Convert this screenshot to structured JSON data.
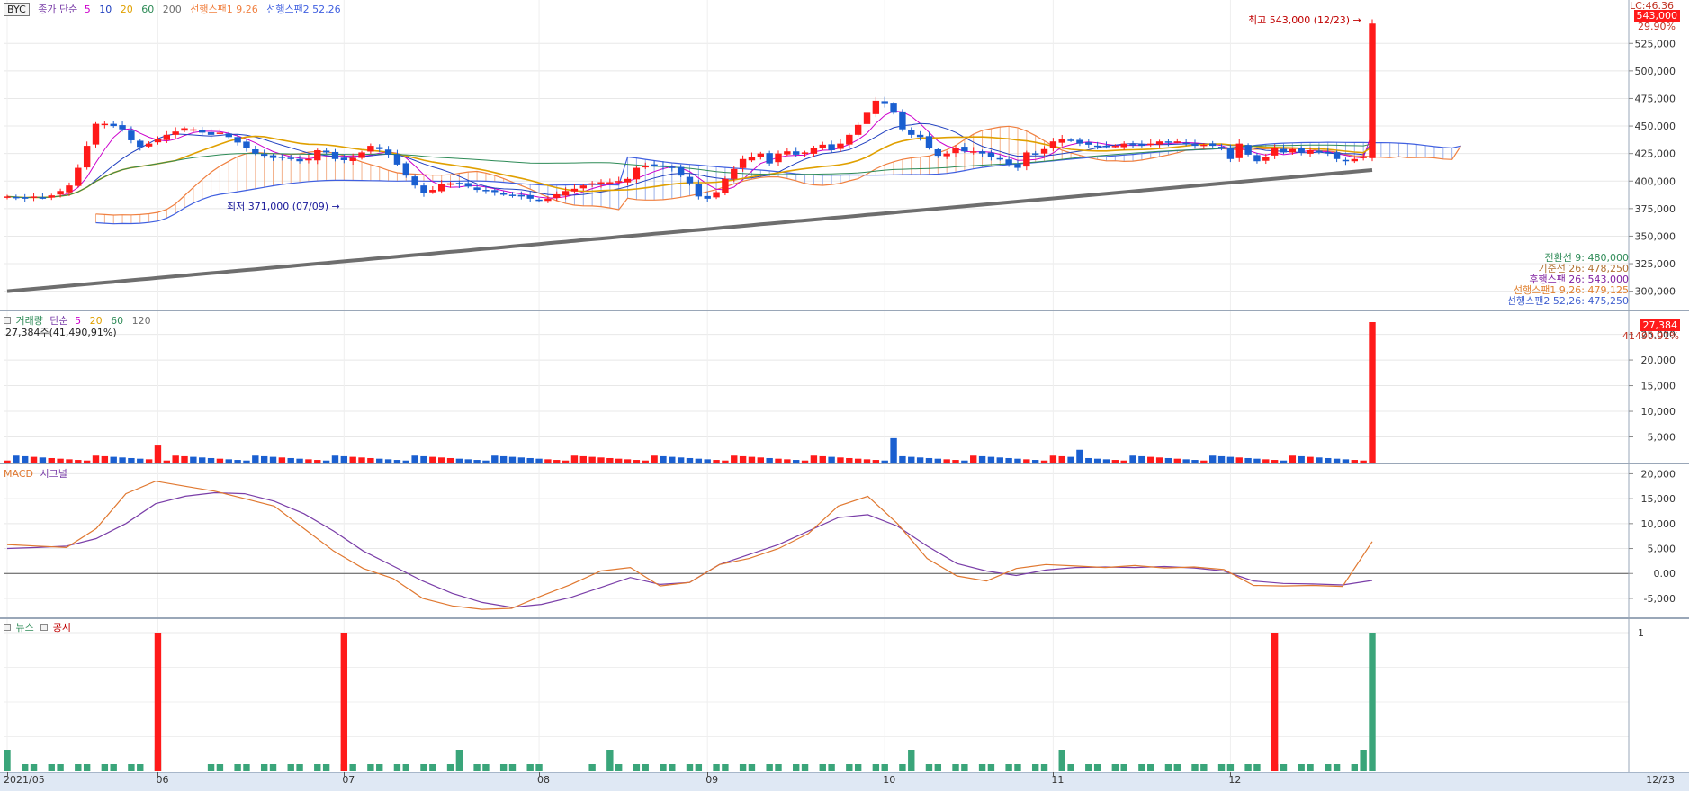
{
  "symbol": "BYC",
  "price_legend": {
    "prefix": "종가 단순",
    "mas": [
      "5",
      "10",
      "20",
      "60",
      "200"
    ],
    "span1": "선행스팬1 9,26",
    "span2": "선행스팬2 52,26"
  },
  "header_right": {
    "lc": "LC:46.36",
    "price_tag": "543,000",
    "pct": "29.90%"
  },
  "annotations": {
    "high": "최고 543,000 (12/23)",
    "low": "최저 371,000 (07/09)"
  },
  "ichimoku_labels": [
    {
      "text": "전환선 9: 480,000",
      "color": "#2e8b57"
    },
    {
      "text": "기준선 26: 478,250",
      "color": "#b07030"
    },
    {
      "text": "후행스팬 26: 543,000",
      "color": "#8020a0"
    },
    {
      "text": "선행스팬1 9,26: 479,125",
      "color": "#e08030"
    },
    {
      "text": "선행스팬2 52,26: 475,250",
      "color": "#4060d0"
    }
  ],
  "volume_legend": {
    "title": "거래량",
    "prefix": "단순",
    "mas": [
      "5",
      "20",
      "60",
      "120"
    ],
    "value": "27,384주(41,490,91%)",
    "last_tag": "27,384",
    "last_pct": "41490.91%"
  },
  "macd_legend": {
    "macd": "MACD",
    "signal": "시그널"
  },
  "news_legend": {
    "news": "뉴스",
    "disclosure": "공시"
  },
  "x_labels": [
    {
      "label": "2021/05",
      "i": 0
    },
    {
      "label": "06",
      "i": 17
    },
    {
      "label": "07",
      "i": 38
    },
    {
      "label": "08",
      "i": 60
    },
    {
      "label": "09",
      "i": 79
    },
    {
      "label": "10",
      "i": 99
    },
    {
      "label": "11",
      "i": 118
    },
    {
      "label": "12",
      "i": 138
    }
  ],
  "x_right_label": "12/23",
  "colors": {
    "up": "#ff1a1a",
    "down": "#1a5fd0",
    "ma5": "#cc00cc",
    "ma10": "#2040c0",
    "ma20": "#e0a000",
    "ma60": "#2e8b57",
    "ma200": "#6e6e6e",
    "span1": "#f08040",
    "span2": "#4060e0",
    "macd": "#7a3ea8",
    "signal": "#e07830",
    "news": "#3aa57a",
    "disclosure": "#ff1a1a"
  },
  "chart_data": [
    {
      "type": "candlestick",
      "title": "BYC",
      "ylim": [
        285000,
        553000
      ],
      "y_ticks": [
        300000,
        325000,
        350000,
        375000,
        400000,
        425000,
        450000,
        475000,
        500000,
        525000
      ],
      "y_tick_labels": [
        "300,000",
        "325,000",
        "350,000",
        "375,000",
        "400,000",
        "425,000",
        "450,000",
        "475,000",
        "500,000",
        "525,000"
      ],
      "series": [
        {
          "name": "close",
          "values": [
            386000,
            385000,
            384000,
            386000,
            385000,
            387000,
            391000,
            396000,
            412000,
            432000,
            452000,
            452000,
            450000,
            447000,
            437000,
            431000,
            434000,
            438000,
            442000,
            445000,
            448000,
            447000,
            444000,
            442000,
            444000,
            440000,
            435000,
            430000,
            425000,
            423000,
            421000,
            422000,
            420000,
            418000,
            420000,
            428000,
            426000,
            420000,
            419000,
            421000,
            426000,
            432000,
            429000,
            424000,
            415000,
            405000,
            396000,
            389000,
            392000,
            397000,
            398000,
            397000,
            395000,
            392000,
            391000,
            390000,
            388000,
            387000,
            386000,
            384000,
            382000,
            384000,
            388000,
            391000,
            393000,
            396000,
            398000,
            399000,
            399000,
            400000,
            402000,
            412000,
            414000,
            415000,
            413000,
            412000,
            405000,
            398000,
            386000,
            384000,
            390000,
            402000,
            411000,
            420000,
            422000,
            425000,
            416000,
            425000,
            427000,
            424000,
            426000,
            430000,
            433000,
            428000,
            434000,
            442000,
            451000,
            462000,
            473000,
            470000,
            462000,
            447000,
            442000,
            440000,
            430000,
            423000,
            425000,
            430000,
            427000,
            427000,
            425000,
            422000,
            420000,
            415000,
            412000,
            426000,
            425000,
            429000,
            436000,
            438000,
            437000,
            434000,
            433000,
            432000,
            431000,
            432000,
            434000,
            433000,
            432000,
            434000,
            436000,
            435000,
            436000,
            434000,
            432000,
            433000,
            432000,
            430000,
            420000,
            434000,
            424000,
            418000,
            422000,
            430000,
            426000,
            429000,
            426000,
            428000,
            426000,
            425000,
            420000,
            418000,
            420000,
            422000,
            543000
          ]
        }
      ],
      "annotations": {
        "high": 543000,
        "low": 371000
      }
    },
    {
      "type": "bar",
      "title": "거래량",
      "ylim": [
        0,
        27384
      ],
      "y_ticks": [
        5000,
        10000,
        15000,
        20000,
        25000
      ],
      "y_tick_labels": [
        "5,000",
        "10,000",
        "15,000",
        "20,000",
        "25,000"
      ],
      "last_value": 27384
    },
    {
      "type": "line",
      "title": "MACD",
      "ylim": [
        -8800,
        20800
      ],
      "y_ticks": [
        -5000,
        0,
        5000,
        10000,
        15000,
        20000
      ],
      "y_tick_labels": [
        "-5,000",
        "0.00",
        "5,000",
        "10,000",
        "15,000",
        "20,000"
      ],
      "series": [
        {
          "name": "MACD",
          "values": [
            5000,
            5200,
            5500,
            7000,
            10000,
            14000,
            15500,
            16200,
            16000,
            14500,
            12000,
            8500,
            4500,
            1500,
            -1500,
            -4000,
            -5800,
            -6800,
            -6200,
            -4800,
            -2800,
            -800,
            -2200,
            -1800,
            1800,
            3800,
            5800,
            8500,
            11200,
            11800,
            9500,
            5500,
            2000,
            500,
            -400,
            700,
            1200,
            1300,
            1200,
            1400,
            1100,
            500,
            -1500,
            -2000,
            -2100,
            -2300,
            -1400
          ]
        },
        {
          "name": "시그널",
          "values": [
            5800,
            5500,
            5200,
            9000,
            16000,
            18500,
            17500,
            16500,
            15000,
            13500,
            9000,
            4500,
            1000,
            -1000,
            -5000,
            -6500,
            -7200,
            -7000,
            -4500,
            -2200,
            500,
            1200,
            -2500,
            -1800,
            1800,
            3000,
            5000,
            8000,
            13500,
            15500,
            10000,
            3000,
            -500,
            -1500,
            1000,
            1800,
            1500,
            1200,
            1600,
            1100,
            1300,
            800,
            -2400,
            -2500,
            -2400,
            -2600,
            6400
          ]
        }
      ]
    },
    {
      "type": "bar",
      "title": "뉴스/공시",
      "ylim": [
        0,
        1
      ],
      "y_ticks": [
        1
      ],
      "y_tick_labels": [
        "1"
      ],
      "disclosure_count": 1,
      "news_count": 1
    }
  ]
}
